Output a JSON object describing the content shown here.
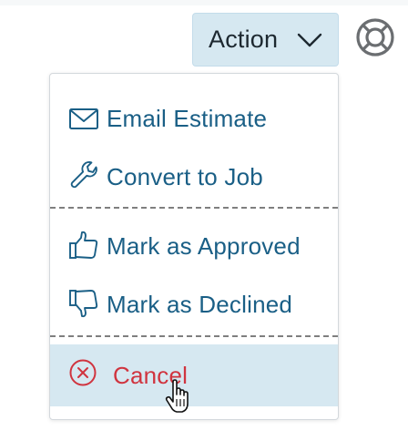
{
  "action_button": {
    "label": "Action",
    "icon": "chevron-down-icon"
  },
  "help_button": {
    "icon": "lifebuoy-icon"
  },
  "menu": {
    "items": [
      {
        "label": "Email Estimate",
        "icon": "envelope-icon"
      },
      {
        "label": "Convert to Job",
        "icon": "wrench-icon"
      },
      {
        "label": "Mark as Approved",
        "icon": "thumbs-up-icon"
      },
      {
        "label": "Mark as Declined",
        "icon": "thumbs-down-icon"
      },
      {
        "label": "Cancel",
        "icon": "circle-x-icon",
        "highlighted": true
      }
    ]
  },
  "colors": {
    "accent_text": "#1a5f86",
    "danger_text": "#d0343f",
    "highlight_bg": "#d6e8f1"
  }
}
